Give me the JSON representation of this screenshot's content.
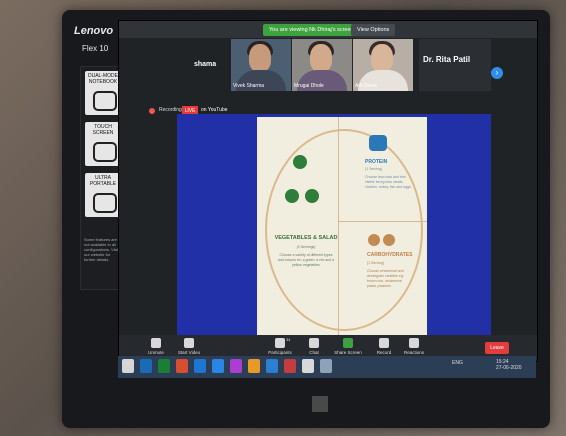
{
  "device": {
    "brand": "Lenovo",
    "model": "Flex 10"
  },
  "sticker": {
    "items": [
      {
        "label": "DUAL-MODE NOTEBOOK"
      },
      {
        "label": "TOUCH SCREEN"
      },
      {
        "label": "ULTRA PORTABLE"
      }
    ],
    "note": "Some features are not available in all configurations. Visit our website for further details."
  },
  "zoom": {
    "viewing_banner": "You are viewing Nk Dhiraj's screen",
    "view_options": "View Options",
    "participants": [
      "Vivek Sharma",
      "Mrugai Dhole",
      "Ark Desai"
    ],
    "active_speaker": "Dr. Rita Patil",
    "left_name": "shama",
    "recording_text": "Recording",
    "live_badge": "LIVE",
    "live_text": "on YouTube",
    "controls": [
      "Unmute",
      "Start Video",
      "Participants",
      "Chat",
      "Share Screen",
      "Record",
      "Reactions"
    ],
    "participants_count": "34",
    "leave": "Leave"
  },
  "slide": {
    "vegetables_label": "VEGETABLES & SALAD",
    "vegetables_servings": "(2 Servings)",
    "vegetables_note": "Choose a variety of different types and colours ex: a green, a red and a yellow vegetables",
    "protein_label": "PROTEIN",
    "protein_servings": "(1 Serving)",
    "protein_note": "Choose lean cuts and trim visible fat eg lean meats, chicken, turkey, fish and eggs",
    "carb_label": "CARBOHYDRATES",
    "carb_servings": "(1 Serving)",
    "carb_note": "Choose wholemeal and wholegrain varieties eg: brown rice, wholemeal pasta, potatoes"
  },
  "taskbar": {
    "tray_text": "ENG",
    "time": "15:24",
    "date": "27-06-2020"
  }
}
